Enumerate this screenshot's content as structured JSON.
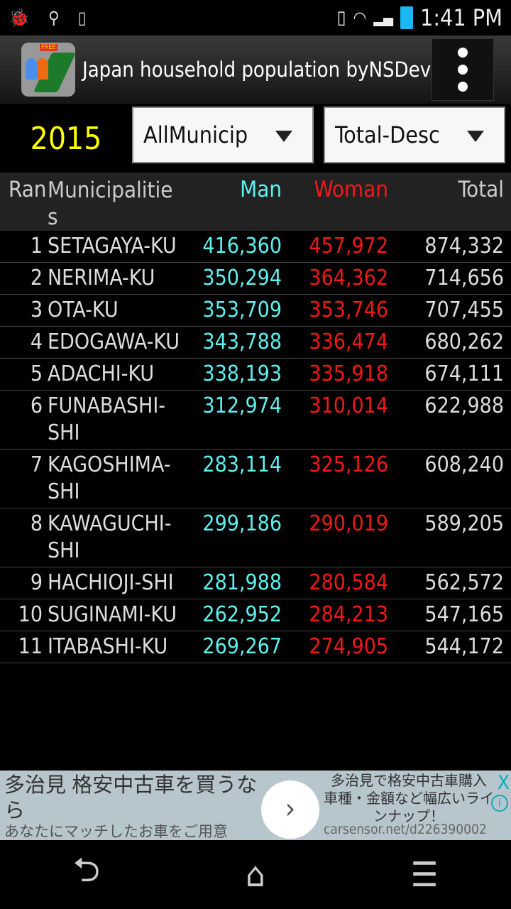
{
  "status_bar": {
    "time": "1:41 PM",
    "icons": [
      "android-debug-icon",
      "usb-icon",
      "screen-rotate-icon",
      "vibrate-icon",
      "wifi-icon",
      "signal-icon",
      "battery-icon"
    ]
  },
  "app_bar": {
    "title": "Japan household population byNSDev",
    "icon_badge": "FREE"
  },
  "controls": {
    "year": "2015",
    "area_select": "AllMunicipalities",
    "sort_select": "Total-Descending"
  },
  "table": {
    "headers": {
      "rank": "Rank",
      "name": "Municipalities",
      "man": "Man",
      "woman": "Woman",
      "total": "Total"
    },
    "rows": [
      {
        "rank": "1",
        "name": "SETAGAYA-KU",
        "man": "416,360",
        "woman": "457,972",
        "total": "874,332"
      },
      {
        "rank": "2",
        "name": "NERIMA-KU",
        "man": "350,294",
        "woman": "364,362",
        "total": "714,656"
      },
      {
        "rank": "3",
        "name": "OTA-KU",
        "man": "353,709",
        "woman": "353,746",
        "total": "707,455"
      },
      {
        "rank": "4",
        "name": "EDOGAWA-KU",
        "man": "343,788",
        "woman": "336,474",
        "total": "680,262"
      },
      {
        "rank": "5",
        "name": "ADACHI-KU",
        "man": "338,193",
        "woman": "335,918",
        "total": "674,111"
      },
      {
        "rank": "6",
        "name": "FUNABASHI-SHI",
        "man": "312,974",
        "woman": "310,014",
        "total": "622,988"
      },
      {
        "rank": "7",
        "name": "KAGOSHIMA-SHI",
        "man": "283,114",
        "woman": "325,126",
        "total": "608,240"
      },
      {
        "rank": "8",
        "name": "KAWAGUCHI-SHI",
        "man": "299,186",
        "woman": "290,019",
        "total": "589,205"
      },
      {
        "rank": "9",
        "name": "HACHIOJI-SHI",
        "man": "281,988",
        "woman": "280,584",
        "total": "562,572"
      },
      {
        "rank": "10",
        "name": "SUGINAMI-KU",
        "man": "262,952",
        "woman": "284,213",
        "total": "547,165"
      },
      {
        "rank": "11",
        "name": "ITABASHI-KU",
        "man": "269,267",
        "woman": "274,905",
        "total": "544,172"
      }
    ]
  },
  "ad": {
    "headline": "多治見 格安中古車を買うなら",
    "sub": "あなたにマッチしたお車をご用意",
    "right_text": "多治見で格安中古車購入 車種・金額など幅広いラインナップ！",
    "url": "carsensor.net/d226390002",
    "go": "›",
    "close": "X",
    "info": "i"
  },
  "nav": {
    "back": "⮌",
    "home": "⌂",
    "menu": "☰"
  }
}
